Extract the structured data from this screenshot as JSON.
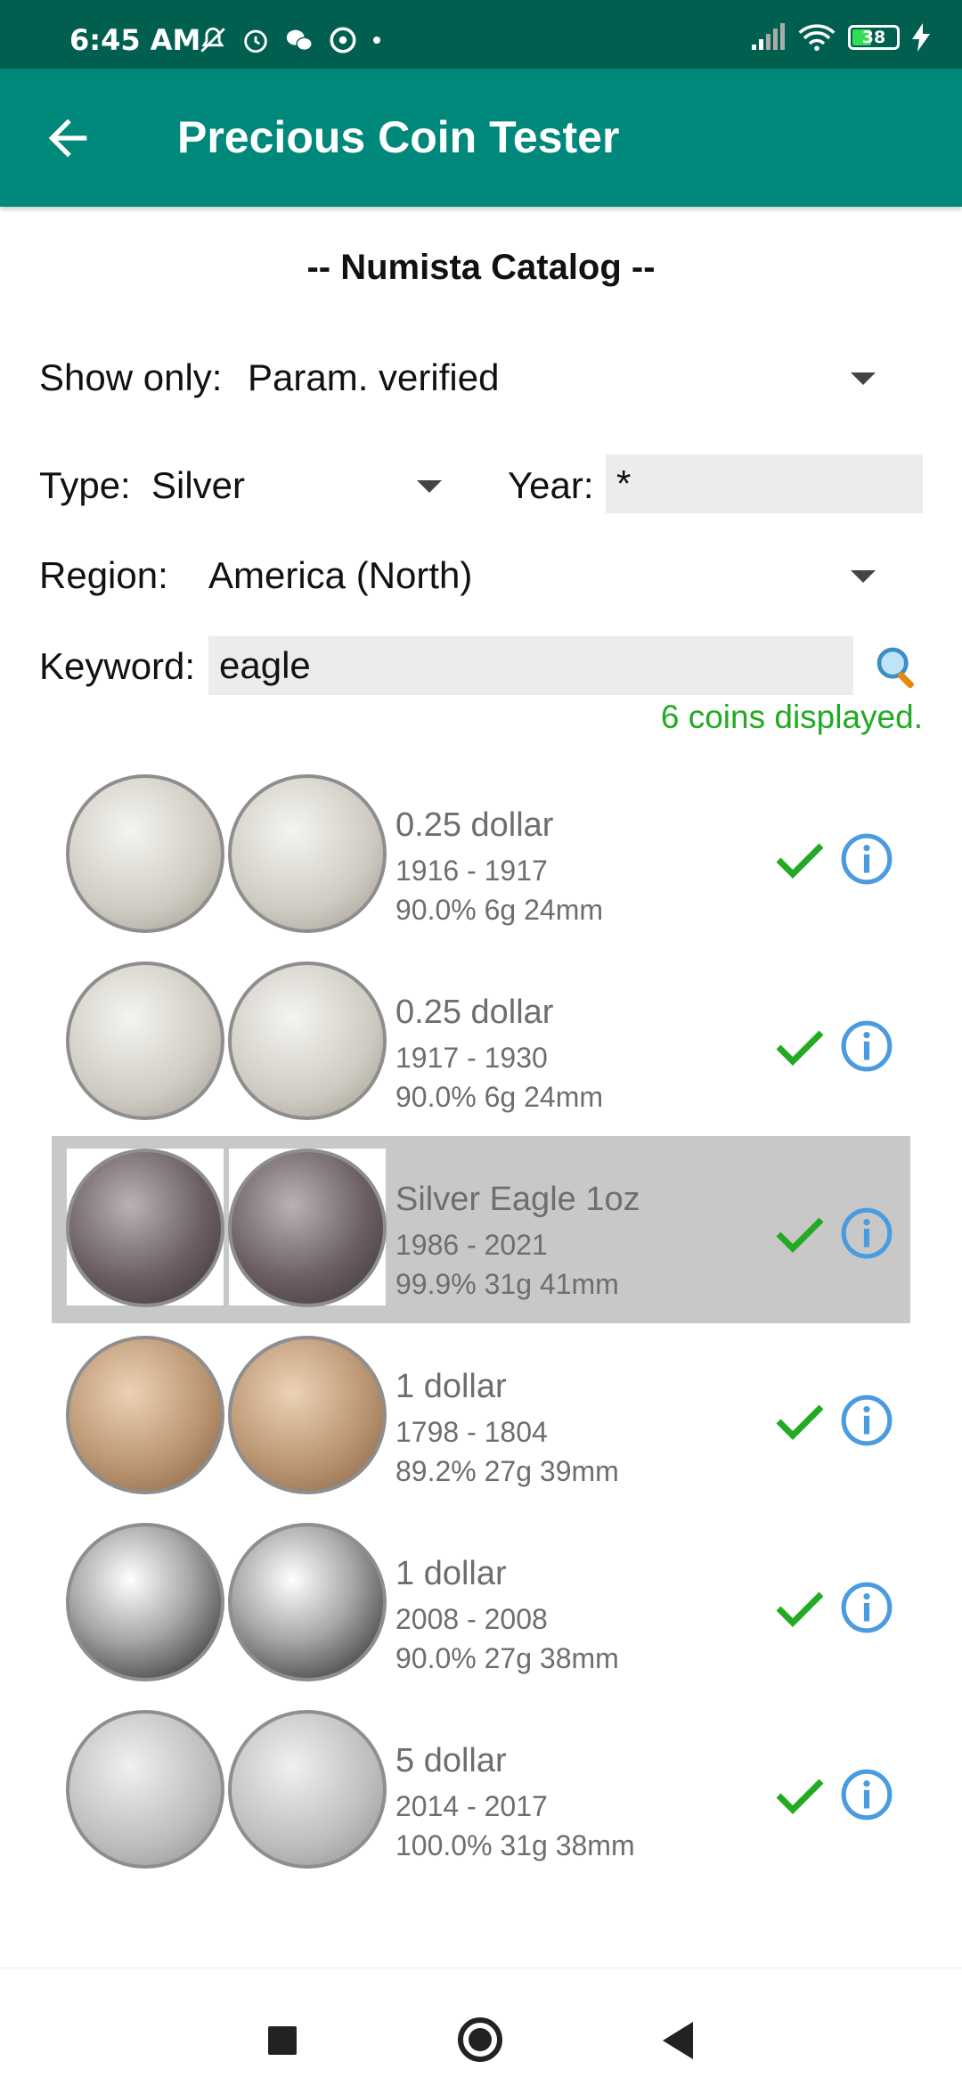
{
  "status_bar": {
    "time": "6:45 AM",
    "battery": "38",
    "icons_left": [
      "mute-bell-icon",
      "alarm-icon",
      "wechat-icon",
      "vpn-icon",
      "dot-icon"
    ],
    "icons_right": [
      "signal-icon",
      "wifi-icon",
      "battery-icon",
      "charging-icon"
    ]
  },
  "app_bar": {
    "title": "Precious Coin Tester",
    "color": "#00897b",
    "status_color": "#005f4f"
  },
  "catalog": {
    "title": "-- Numista Catalog --"
  },
  "filters": {
    "show_only_label": "Show only:",
    "show_only_value": "Param. verified",
    "type_label": "Type:",
    "type_value": "Silver",
    "year_label": "Year:",
    "year_value": "*",
    "region_label": "Region:",
    "region_value": "America (North)",
    "keyword_label": "Keyword:",
    "keyword_value": "eagle",
    "count_text": "6 coins displayed."
  },
  "coins": [
    {
      "name": "0.25 dollar",
      "years": "1916 - 1917",
      "spec": "90.0% 6g 24mm",
      "selected": false,
      "tone": "silver"
    },
    {
      "name": "0.25 dollar",
      "years": "1917 - 1930",
      "spec": "90.0% 6g 24mm",
      "selected": false,
      "tone": "silver"
    },
    {
      "name": "Silver Eagle 1oz",
      "years": "1986 - 2021",
      "spec": "99.9% 31g 41mm",
      "selected": true,
      "tone": "dark"
    },
    {
      "name": "1 dollar",
      "years": "1798 - 1804",
      "spec": "89.2% 27g 39mm",
      "selected": false,
      "tone": "bronze"
    },
    {
      "name": "1 dollar",
      "years": "2008 - 2008",
      "spec": "90.0% 27g 38mm",
      "selected": false,
      "tone": "proof"
    },
    {
      "name": "5 dollar",
      "years": "2014 - 2017",
      "spec": "100.0% 31g 38mm",
      "selected": false,
      "tone": "bright"
    }
  ],
  "colors": {
    "accent_green": "#22aa22",
    "info_blue": "#4a9be0"
  }
}
